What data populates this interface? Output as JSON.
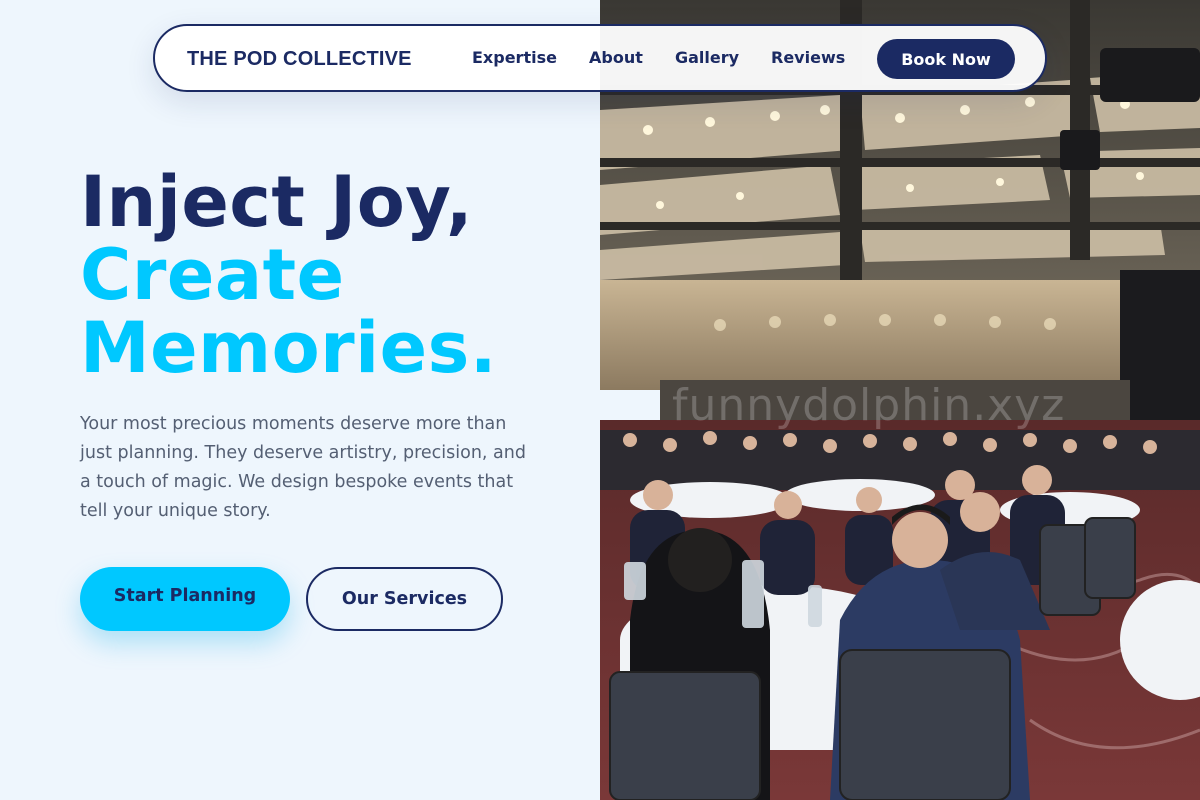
{
  "brand": {
    "name": "THE POD COLLECTIVE"
  },
  "nav": {
    "links": [
      "Expertise",
      "About",
      "Gallery",
      "Reviews"
    ],
    "cta_label": "Book Now"
  },
  "hero": {
    "title_line1": "Inject Joy,",
    "title_line2": "Create",
    "title_line3": "Memories.",
    "description": "Your most precious moments deserve more than just planning. They deserve artistry, precision, and a touch of magic. We design bespoke events that tell your unique story.",
    "primary_cta": "Start Planning",
    "secondary_cta": "Our Services"
  },
  "photo": {
    "watermark": "funnydolphin.xyz"
  },
  "colors": {
    "navy": "#1b2a63",
    "accent": "#00c8ff",
    "background": "#eef6fd",
    "body_text": "#545f73"
  }
}
